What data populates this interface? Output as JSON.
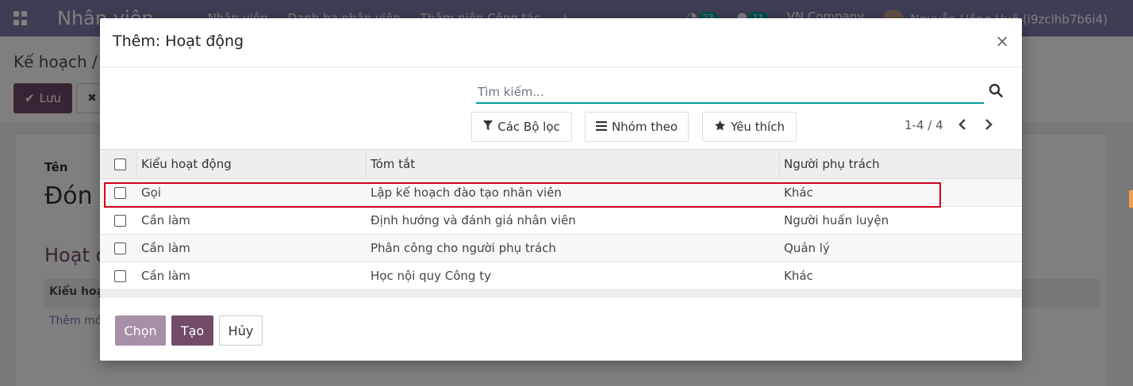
{
  "background": {
    "navbar": {
      "app_name": "Nhân viên",
      "menu": [
        "Nhân viên",
        "Danh bạ nhân viên",
        "Thâm niên Công tác"
      ],
      "activities_count": "23",
      "messages_count": "11",
      "company": "VN Company",
      "user": "Nguyễn Hồng Huệ (i9zclhb7b6i4)"
    },
    "breadcrumb": "Kế hoạch /",
    "save_label": "Lưu",
    "form": {
      "name_label": "Tên",
      "name_value": "Đón",
      "section_title": "Hoạt đ",
      "table_header": "Kiểu hoạ",
      "add_line": "Thêm mớ"
    }
  },
  "modal": {
    "title": "Thêm: Hoạt động",
    "close_label": "×",
    "search": {
      "placeholder": "Tìm kiếm..."
    },
    "toolbar": {
      "filters_label": "Các Bộ lọc",
      "group_by_label": "Nhóm theo",
      "favorites_label": "Yêu thích"
    },
    "pager": {
      "value": "1-4 / 4"
    },
    "list": {
      "columns": [
        "Kiểu hoạt động",
        "Tóm tắt",
        "Người phụ trách"
      ],
      "rows": [
        {
          "type": "Gọi",
          "summary": "Lập kế hoạch đào tạo nhân viên",
          "responsible": "Khác",
          "highlighted": true
        },
        {
          "type": "Cần làm",
          "summary": "Định hướng và đánh giá nhân viên",
          "responsible": "Người huấn luyện",
          "highlighted": false
        },
        {
          "type": "Cần làm",
          "summary": "Phân công cho người phụ trách",
          "responsible": "Quản lý",
          "highlighted": false
        },
        {
          "type": "Cần làm",
          "summary": "Học nội quy Công ty",
          "responsible": "Khác",
          "highlighted": false
        }
      ]
    },
    "footer": {
      "select_label": "Chọn",
      "create_label": "Tạo",
      "cancel_label": "Hủy"
    }
  },
  "colors": {
    "primary": "#714b67",
    "primary_disabled": "#a88fa8",
    "accent": "#00a09d",
    "highlight_border": "#d0021b",
    "navbar": "#7c7bad"
  },
  "icons": {
    "search": "search-icon",
    "filter": "filter-icon",
    "group_by": "list-icon",
    "favorites": "star-icon",
    "prev": "chevron-left-icon",
    "next": "chevron-right-icon"
  }
}
